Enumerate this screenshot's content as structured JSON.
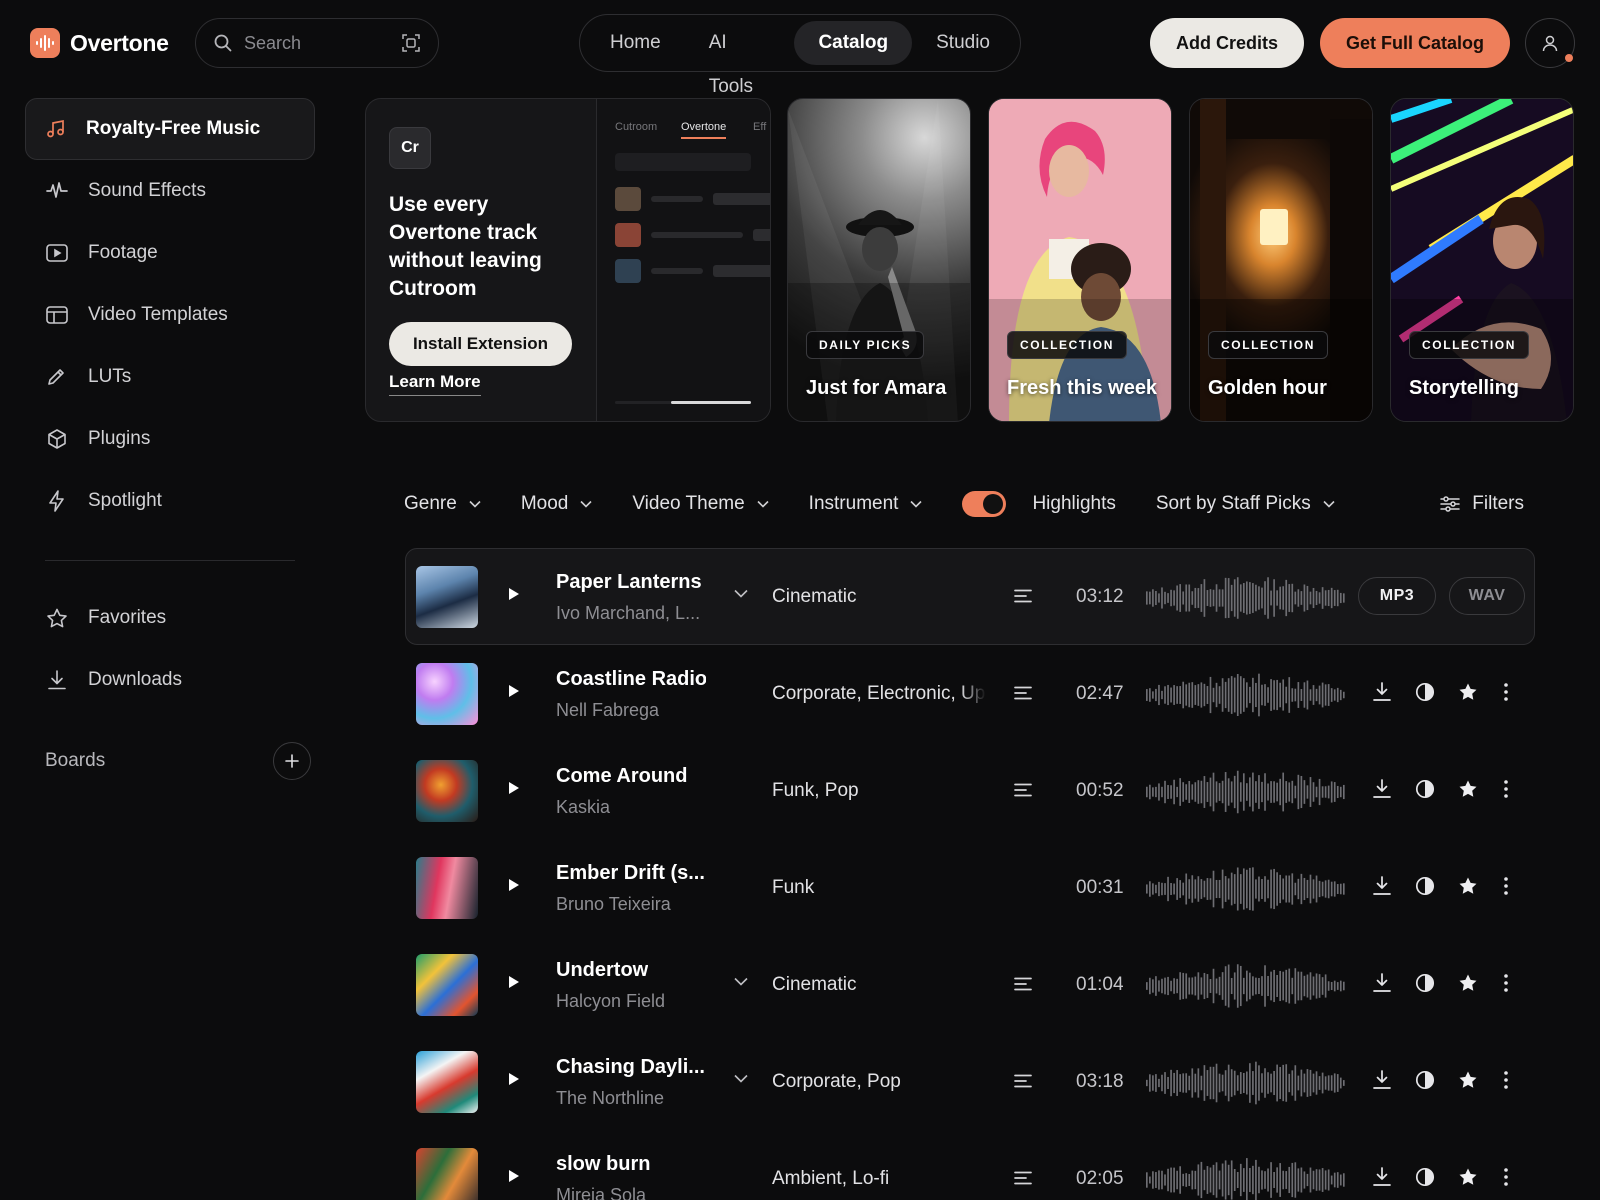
{
  "app": {
    "name": "Overtone"
  },
  "search": {
    "placeholder": "Search"
  },
  "nav": {
    "tabs": [
      "Home",
      "AI Tools",
      "Catalog",
      "Studio"
    ],
    "active": "Catalog"
  },
  "header": {
    "add_credits": "Add Credits",
    "get_catalog": "Get Full Catalog"
  },
  "sidebar": {
    "items": [
      {
        "label": "Royalty-Free Music",
        "icon": "music-note-icon"
      },
      {
        "label": "Sound Effects",
        "icon": "waveform-icon"
      },
      {
        "label": "Footage",
        "icon": "play-square-icon"
      },
      {
        "label": "Video Templates",
        "icon": "layout-icon"
      },
      {
        "label": "LUTs",
        "icon": "pencil-icon"
      },
      {
        "label": "Plugins",
        "icon": "cube-icon"
      },
      {
        "label": "Spotlight",
        "icon": "lightning-icon"
      }
    ],
    "secondary": [
      {
        "label": "Favorites",
        "icon": "star-icon"
      },
      {
        "label": "Downloads",
        "icon": "download-icon"
      }
    ],
    "boards_label": "Boards"
  },
  "promo": {
    "badge": "Cr",
    "title": "Use every Overtone track without leaving Cutroom",
    "install": "Install Extension",
    "learn_more": "Learn More",
    "mock_tabs": [
      "Cutroom",
      "Overtone",
      "Eff"
    ]
  },
  "cards": [
    {
      "tag": "DAILY PICKS",
      "title": "Just for Amara"
    },
    {
      "tag": "COLLECTION",
      "title": "Fresh this week"
    },
    {
      "tag": "COLLECTION",
      "title": "Golden hour"
    },
    {
      "tag": "COLLECTION",
      "title": "Storytelling"
    }
  ],
  "filters": {
    "genre": "Genre",
    "mood": "Mood",
    "video_theme": "Video Theme",
    "instrument": "Instrument",
    "highlights": "Highlights",
    "highlights_on": true,
    "sort": "Sort by Staff Picks",
    "filters": "Filters"
  },
  "tracks": [
    {
      "title": "Paper Lanterns",
      "artist": "Ivo Marchand, L...",
      "genre": "Cinematic",
      "duration": "03:12",
      "has_versions": true,
      "has_stems": true,
      "selected": true,
      "formats": [
        "MP3",
        "WAV"
      ]
    },
    {
      "title": "Coastline Radio",
      "artist": "Nell Fabrega",
      "genre": "Corporate, Electronic, Upbeat",
      "duration": "02:47",
      "has_versions": false,
      "has_stems": true
    },
    {
      "title": "Come Around",
      "artist": "Kaskia",
      "genre": "Funk, Pop",
      "duration": "00:52",
      "has_versions": false,
      "has_stems": true
    },
    {
      "title": "Ember Drift (s...",
      "artist": "Bruno Teixeira",
      "genre": "Funk",
      "duration": "00:31",
      "has_versions": false,
      "has_stems": false
    },
    {
      "title": "Undertow",
      "artist": "Halcyon Field",
      "genre": "Cinematic",
      "duration": "01:04",
      "has_versions": true,
      "has_stems": true
    },
    {
      "title": "Chasing Dayli...",
      "artist": "The Northline",
      "genre": "Corporate, Pop",
      "duration": "03:18",
      "has_versions": true,
      "has_stems": true
    },
    {
      "title": "slow burn",
      "artist": "Mireia Sola",
      "genre": "Ambient, Lo-fi",
      "duration": "02:05",
      "has_versions": false,
      "has_stems": true
    }
  ],
  "colors": {
    "accent": "#ee7f5b",
    "background": "#0c0c0d",
    "surface": "#161618"
  }
}
